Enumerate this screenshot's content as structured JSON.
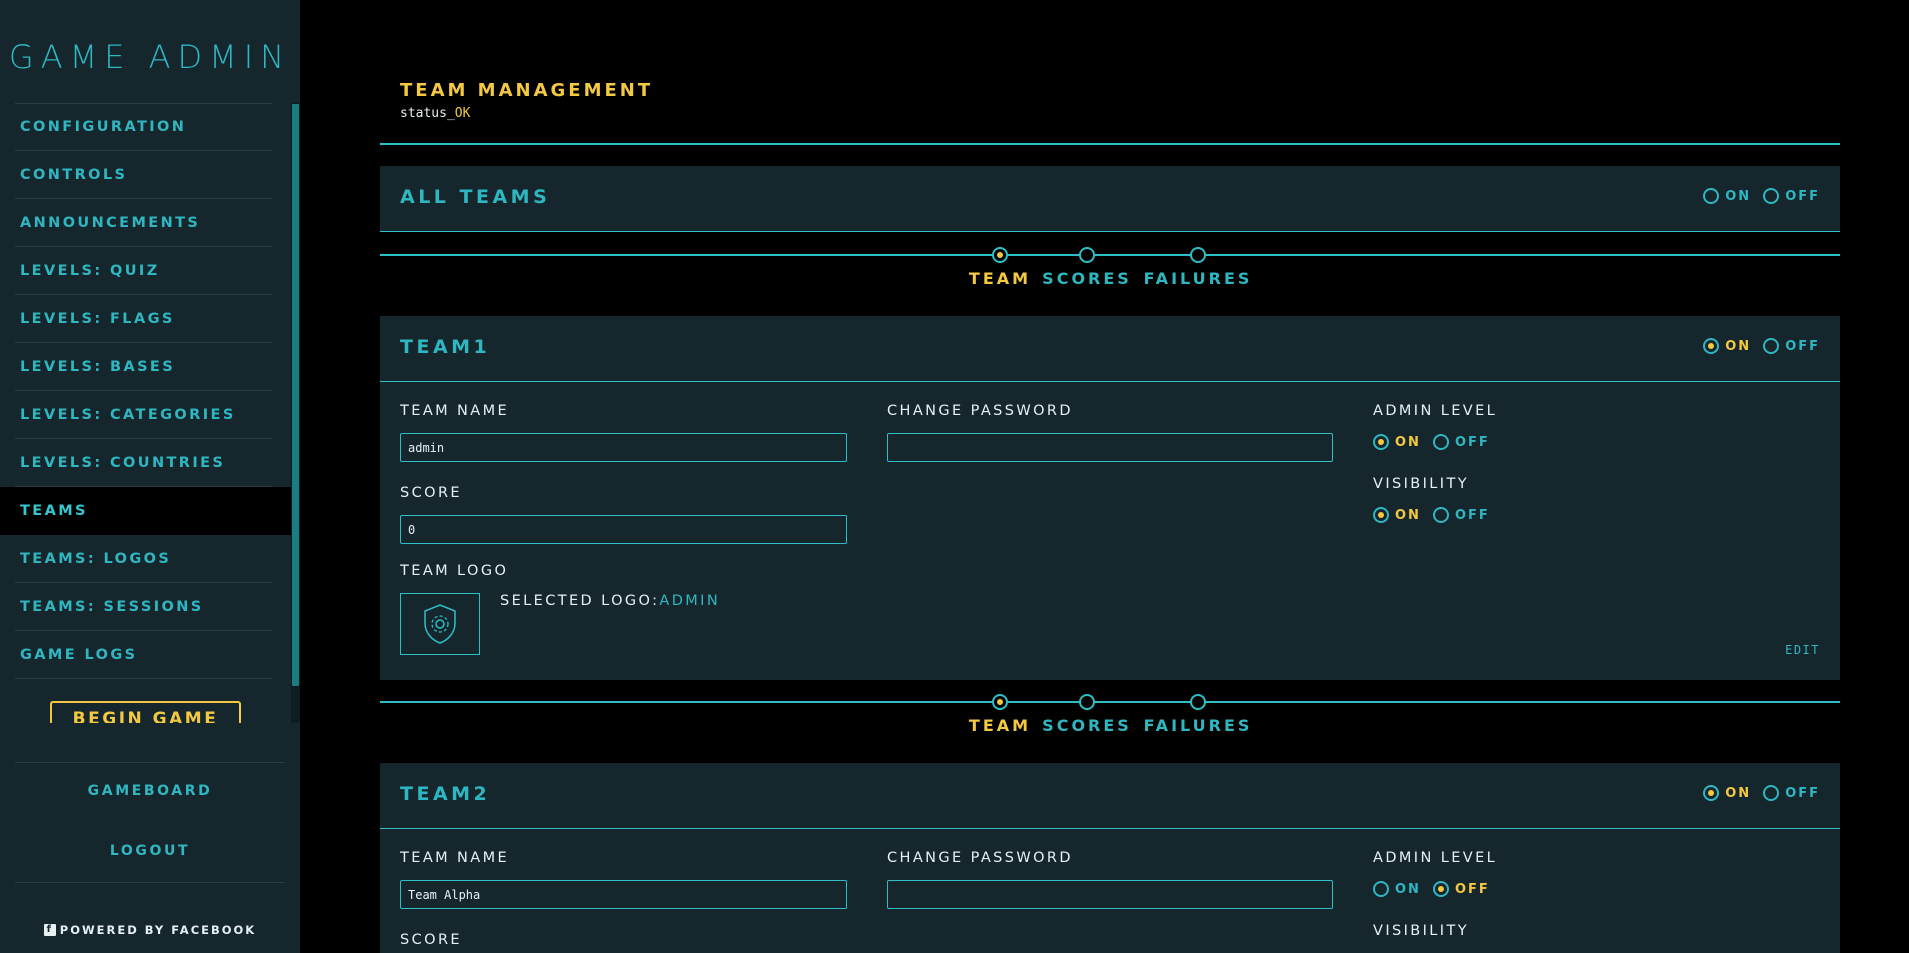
{
  "sidebar": {
    "brand": "GAME ADMIN",
    "nav": [
      {
        "label": "CONFIGURATION",
        "active": false
      },
      {
        "label": "CONTROLS",
        "active": false
      },
      {
        "label": "ANNOUNCEMENTS",
        "active": false
      },
      {
        "label": "LEVELS: QUIZ",
        "active": false
      },
      {
        "label": "LEVELS: FLAGS",
        "active": false
      },
      {
        "label": "LEVELS: BASES",
        "active": false
      },
      {
        "label": "LEVELS: CATEGORIES",
        "active": false
      },
      {
        "label": "LEVELS: COUNTRIES",
        "active": false
      },
      {
        "label": "TEAMS",
        "active": true
      },
      {
        "label": "TEAMS: LOGOS",
        "active": false
      },
      {
        "label": "TEAMS: SESSIONS",
        "active": false
      },
      {
        "label": "GAME LOGS",
        "active": false
      }
    ],
    "begin_game": "BEGIN GAME",
    "gameboard": "GAMEBOARD",
    "logout": "LOGOUT",
    "powered_by": "POWERED BY FACEBOOK",
    "fb_icon": "f"
  },
  "header": {
    "title": "TEAM MANAGEMENT",
    "status_prefix": "status_",
    "status_value": "OK"
  },
  "all_teams": {
    "title": "ALL TEAMS",
    "on": "ON",
    "off": "OFF"
  },
  "steps": {
    "team": "TEAM",
    "scores": "SCORES",
    "failures": "FAILURES"
  },
  "team1": {
    "title": "TEAM1",
    "on": "ON",
    "off": "OFF",
    "team_name_label": "TEAM NAME",
    "team_name_value": "admin",
    "change_password_label": "CHANGE PASSWORD",
    "password_value": "",
    "admin_level_label": "ADMIN LEVEL",
    "visibility_label": "VISIBILITY",
    "score_label": "SCORE",
    "score_value": "0",
    "team_logo_label": "TEAM LOGO",
    "selected_logo_label": "SELECTED LOGO:",
    "selected_logo_value": "ADMIN",
    "edit": "EDIT",
    "logo_icon": "shield-gear-icon"
  },
  "team2": {
    "title": "TEAM2",
    "on": "ON",
    "off": "OFF",
    "team_name_label": "TEAM NAME",
    "team_name_value": "Team Alpha",
    "change_password_label": "CHANGE PASSWORD",
    "password_value": "",
    "admin_level_label": "ADMIN LEVEL",
    "visibility_label": "VISIBILITY",
    "score_label": "SCORE"
  },
  "colors": {
    "accent": "#2dbfc6",
    "highlight": "#f4c942",
    "panel": "#15262d",
    "background": "#000000"
  }
}
